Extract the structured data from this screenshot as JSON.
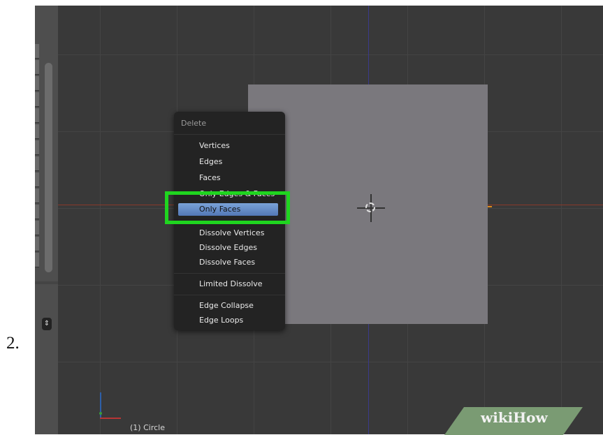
{
  "step_number": "2.",
  "menu": {
    "title": "Delete",
    "items": [
      "Vertices",
      "Edges",
      "Faces",
      "Only Edges & Faces",
      "Only Faces",
      "Dissolve Vertices",
      "Dissolve Edges",
      "Dissolve Faces",
      "Limited Dissolve",
      "Edge Collapse",
      "Edge Loops"
    ],
    "highlighted_item": "Only Faces"
  },
  "viewport": {
    "object_label": "(1) Circle"
  },
  "left_panel": {
    "stepper_icon": "updown-arrows-icon"
  },
  "watermark": "wikiHow",
  "colors": {
    "highlight_frame": "#1fd51f",
    "menu_highlight": "#6a8fd0",
    "plane": "#7a787d",
    "viewport_bg": "#393939"
  }
}
